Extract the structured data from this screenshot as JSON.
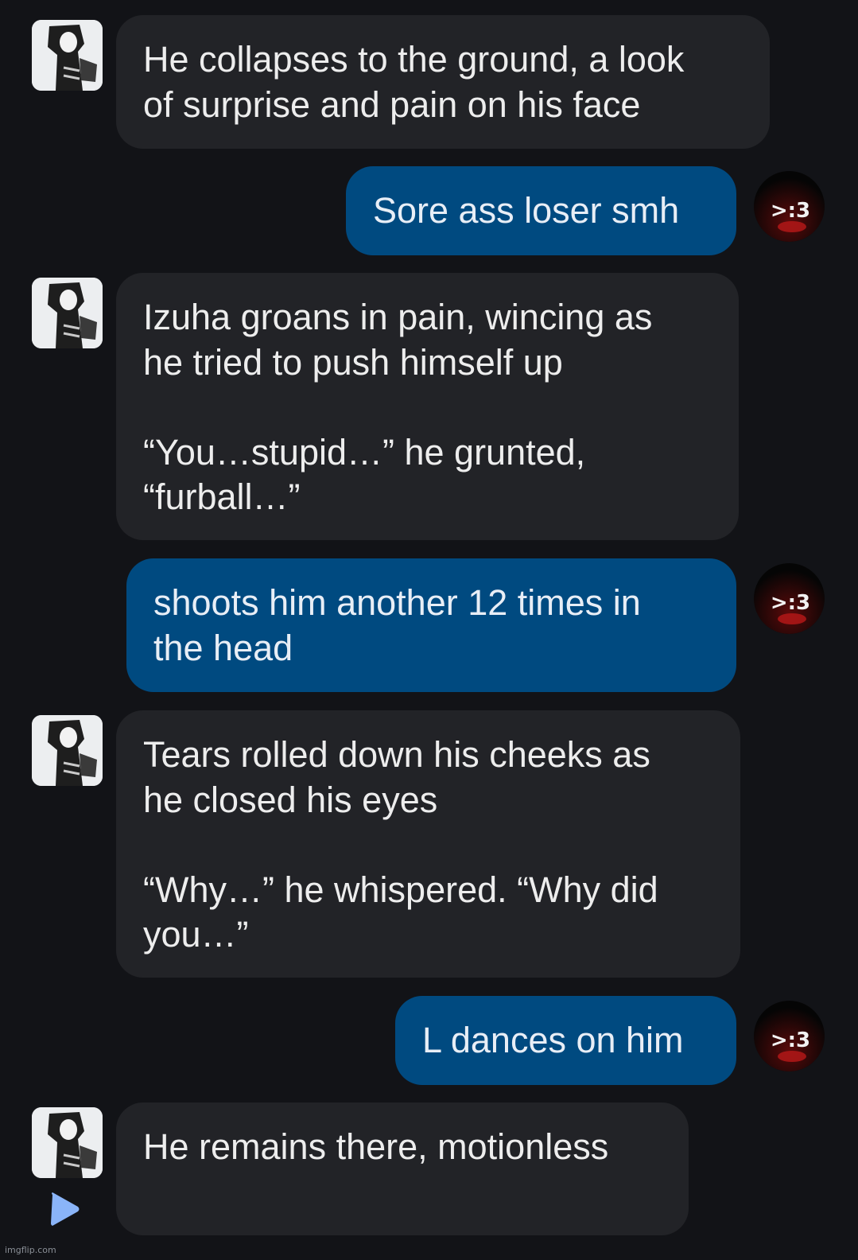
{
  "conversation": {
    "bot_avatar_icon": "character-avatar",
    "user_avatar_icon": "red-smirk-face-avatar",
    "user_avatar_text": ">:3",
    "messages": [
      {
        "sender": "bot",
        "text": "He collapses to the ground, a look\nof surprise and pain on his face"
      },
      {
        "sender": "user",
        "text": "Sore ass loser smh"
      },
      {
        "sender": "bot",
        "text": "Izuha groans in pain, wincing as\nhe tried to push himself up\n\n“You…stupid…” he grunted,\n“furball…”"
      },
      {
        "sender": "user",
        "text": "shoots him another 12 times in\nthe head"
      },
      {
        "sender": "bot",
        "text": "Tears rolled down his cheeks as\nhe closed his eyes\n\n“Why…” he whispered. “Why did\nyou…”"
      },
      {
        "sender": "user",
        "text": "L dances on him"
      },
      {
        "sender": "bot",
        "text": "He remains there, motionless"
      }
    ]
  },
  "controls": {
    "play_icon": "play-icon"
  },
  "watermark": "imgflip.com",
  "colors": {
    "background": "#121317",
    "bot_bubble": "#222327",
    "user_bubble": "#004a80",
    "play_icon": "#8ab4f8"
  }
}
